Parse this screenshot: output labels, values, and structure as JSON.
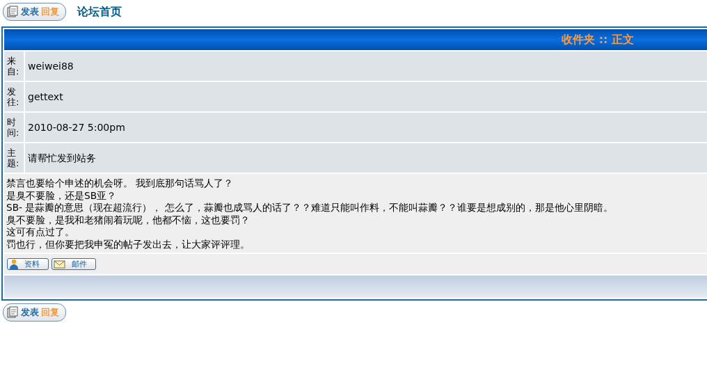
{
  "top_bar": {
    "reply_button": {
      "label": "发表",
      "accent": "回复"
    },
    "home_link": "论坛首页"
  },
  "panel": {
    "title": "收件夹 :: 正文",
    "fields": [
      {
        "label": "来自:",
        "value": "weiwei88"
      },
      {
        "label": "发往:",
        "value": "gettext"
      },
      {
        "label": "时间:",
        "value": "2010-08-27 5:00pm"
      },
      {
        "label": "主题:",
        "value": "请帮忙发到站务"
      }
    ],
    "message_lines": [
      "禁言也要给个申述的机会呀。 我到底那句话骂人了？",
      "是臭不要脸，还是SB亚？",
      "SB- 是蒜瓣的意思（现在超流行）， 怎么了，蒜瓣也成骂人的话了？？难道只能叫作料，不能叫蒜瓣？？谁要是想成别的，那是他心里阴暗。",
      "臭不要脸，是我和老猪闹着玩呢，他都不恼，这也要罚？",
      "这可有点过了。",
      "罚也行，但你要把我申冤的帖子发出去，让大家评评理。"
    ],
    "actions": [
      {
        "kind": "profile",
        "label": "资料"
      },
      {
        "kind": "mail",
        "label": "邮件"
      }
    ]
  },
  "bottom_bar": {
    "reply_button": {
      "label": "发表",
      "accent": "回复"
    }
  }
}
